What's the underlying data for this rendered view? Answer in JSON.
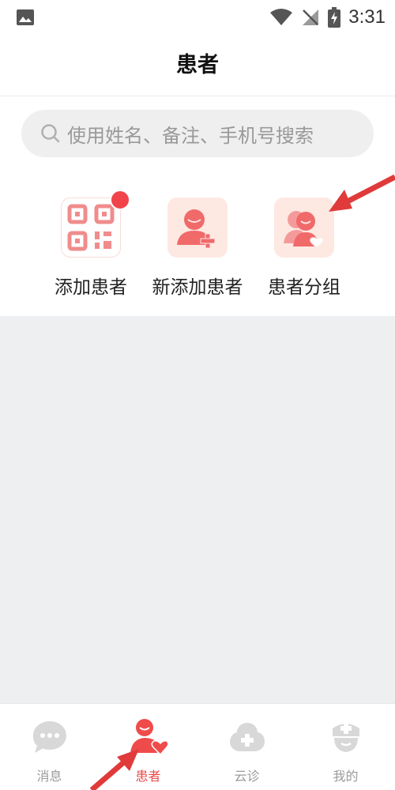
{
  "status": {
    "time": "3:31"
  },
  "header": {
    "title": "患者"
  },
  "search": {
    "placeholder": "使用姓名、备注、手机号搜索"
  },
  "actions": [
    {
      "label": "添加患者",
      "icon": "qr-code-icon",
      "has_badge": true
    },
    {
      "label": "新添加患者",
      "icon": "add-user-icon"
    },
    {
      "label": "患者分组",
      "icon": "patient-group-icon"
    }
  ],
  "tabs": [
    {
      "label": "消息",
      "icon": "chat-icon",
      "active": false
    },
    {
      "label": "患者",
      "icon": "patient-icon",
      "active": true
    },
    {
      "label": "云诊",
      "icon": "cloud-consult-icon",
      "active": false
    },
    {
      "label": "我的",
      "icon": "doctor-profile-icon",
      "active": false
    }
  ],
  "colors": {
    "accent": "#e84b4b",
    "tile_bg": "#fde8e2",
    "panel_bg": "#eeeff1"
  }
}
